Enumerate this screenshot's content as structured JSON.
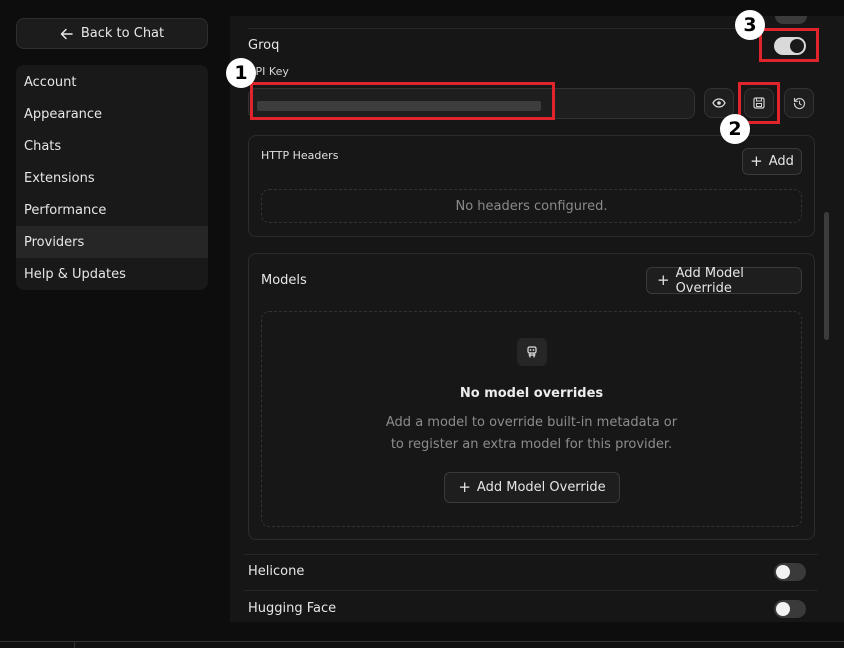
{
  "sidebar": {
    "back_label": "Back to Chat",
    "items": [
      {
        "label": "Account",
        "active": false
      },
      {
        "label": "Appearance",
        "active": false
      },
      {
        "label": "Chats",
        "active": false
      },
      {
        "label": "Extensions",
        "active": false
      },
      {
        "label": "Performance",
        "active": false
      },
      {
        "label": "Providers",
        "active": true
      },
      {
        "label": "Help & Updates",
        "active": false
      }
    ]
  },
  "groq": {
    "name": "Groq",
    "enabled": true,
    "api_key_label": "API Key",
    "http_headers": {
      "title": "HTTP Headers",
      "add_label": "Add",
      "empty_text": "No headers configured."
    },
    "models": {
      "title": "Models",
      "add_override_label": "Add Model Override",
      "empty_title": "No model overrides",
      "empty_desc_line1": "Add a model to override built-in metadata or",
      "empty_desc_line2": "to register an extra model for this provider.",
      "add_override_center_label": "Add Model Override"
    }
  },
  "other_providers": [
    {
      "name": "Helicone",
      "enabled": false
    },
    {
      "name": "Hugging Face",
      "enabled": false
    }
  ],
  "annotations": {
    "badge1": "1",
    "badge2": "2",
    "badge3": "3"
  },
  "colors": {
    "annotation_red": "#e0242b",
    "background": "#0d0d0d",
    "panel": "#161616"
  }
}
